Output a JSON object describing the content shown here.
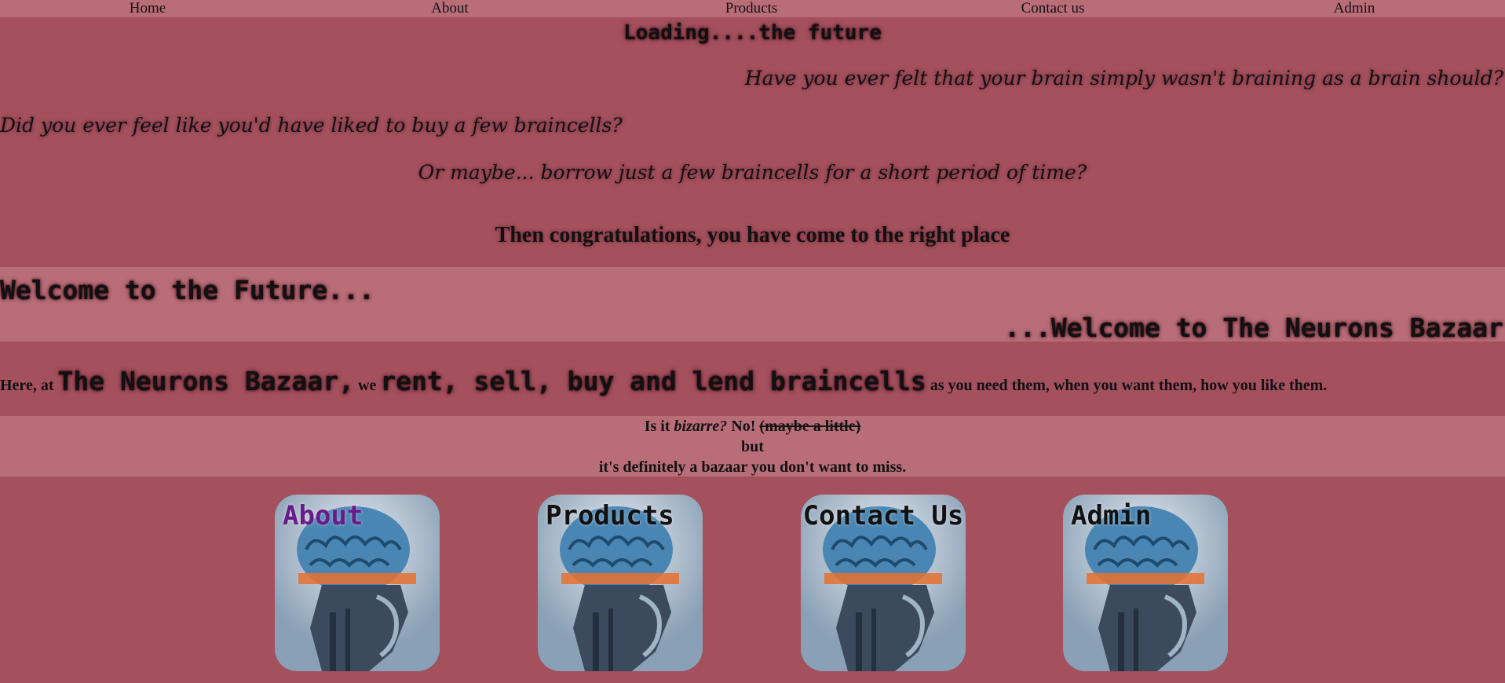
{
  "nav": {
    "items": [
      "Home",
      "About",
      "Products",
      "Contact us",
      "Admin"
    ]
  },
  "hero": {
    "loading": "Loading....the future",
    "line1": "Have you ever felt that your brain simply wasn't braining as a brain should?",
    "line2": "Did you ever feel like you'd have liked to buy a few braincells?",
    "line3": "Or maybe... borrow just a few braincells for a short period of time?",
    "congrats": "Then congratulations, you have come to the right place"
  },
  "welcome": {
    "line1": "Welcome to the Future...",
    "line2": "...Welcome to The Neurons Bazaar"
  },
  "pitch": {
    "prefix": "Here, at",
    "brand": "The Neurons Bazaar,",
    "we": "we",
    "verbs": "rent, sell, buy and lend braincells",
    "suffix": "as you need them, when you want them, how you like them."
  },
  "bizarre": {
    "is_it": "Is it",
    "bizarre": "bizarre?",
    "no": "No!",
    "strike": "(maybe a little)",
    "but": "but",
    "closing": "it's definitely a bazaar you don't want to miss."
  },
  "cards": [
    {
      "label": "About",
      "color": "#6a1a8a"
    },
    {
      "label": "Products",
      "color": "#111111"
    },
    {
      "label": "Contact Us",
      "color": "#111111"
    },
    {
      "label": "Admin",
      "color": "#111111"
    }
  ],
  "colors": {
    "background": "#a4505d",
    "band": "#b96d78",
    "text": "#111111"
  }
}
